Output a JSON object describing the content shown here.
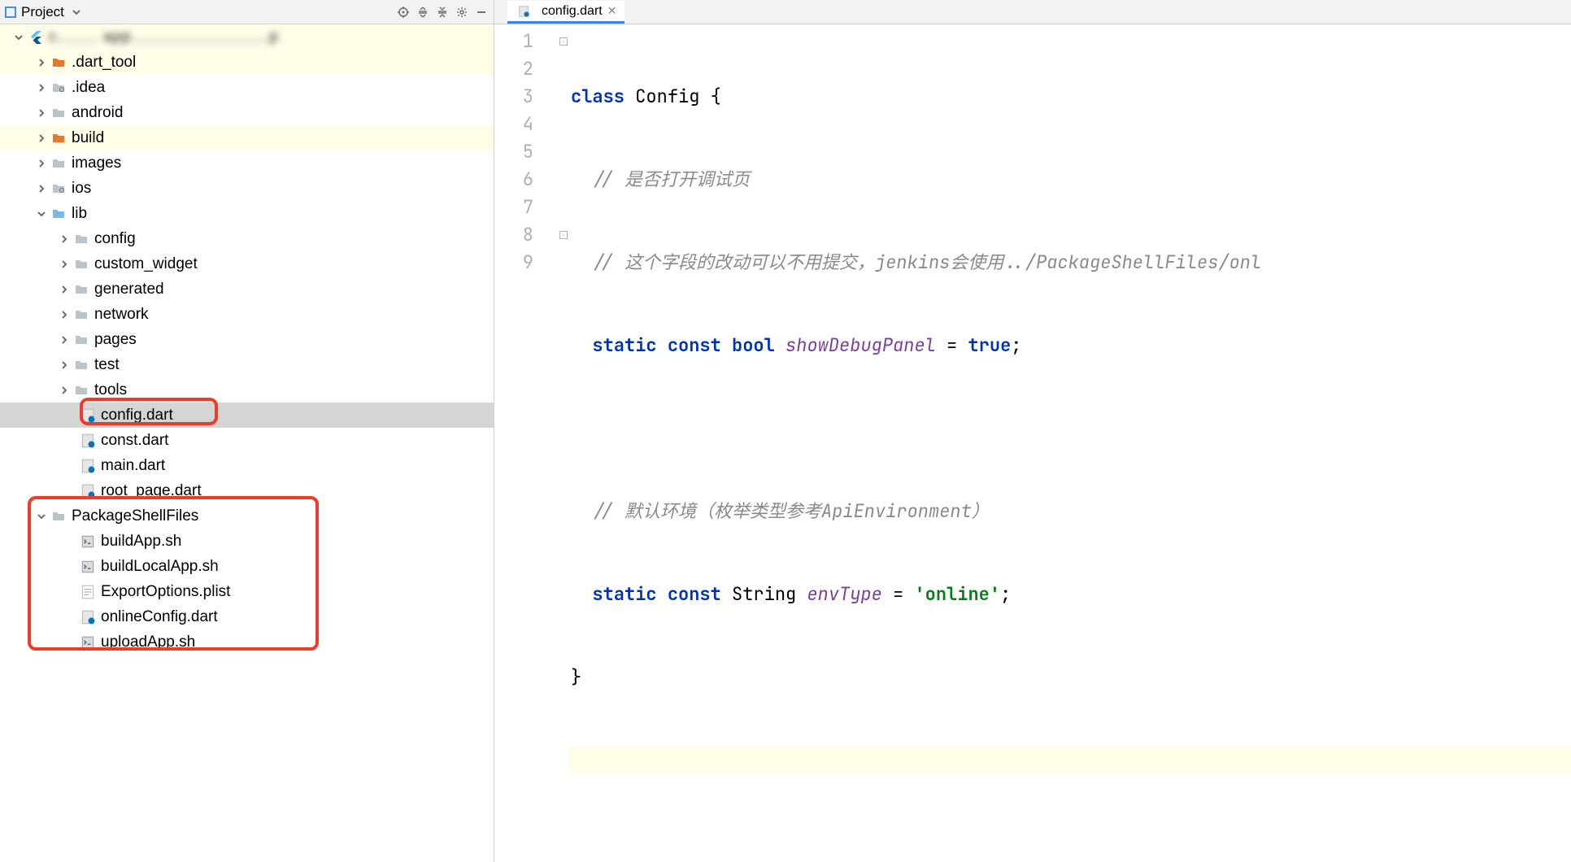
{
  "toolbar": {
    "project_label": "Project"
  },
  "tree": {
    "root_label": "c........ app...........................p",
    "items": [
      {
        "label": ".dart_tool",
        "icon": "folder-orange",
        "indent": 1,
        "arrow": "right",
        "hl": "yellow"
      },
      {
        "label": ".idea",
        "icon": "folder-gear",
        "indent": 1,
        "arrow": "right"
      },
      {
        "label": "android",
        "icon": "folder",
        "indent": 1,
        "arrow": "right"
      },
      {
        "label": "build",
        "icon": "folder-orange",
        "indent": 1,
        "arrow": "right",
        "hl": "yellow"
      },
      {
        "label": "images",
        "icon": "folder",
        "indent": 1,
        "arrow": "right"
      },
      {
        "label": "ios",
        "icon": "folder-gear",
        "indent": 1,
        "arrow": "right"
      },
      {
        "label": "lib",
        "icon": "folder-blue",
        "indent": 1,
        "arrow": "down"
      },
      {
        "label": "config",
        "icon": "folder",
        "indent": 2,
        "arrow": "right"
      },
      {
        "label": "custom_widget",
        "icon": "folder",
        "indent": 2,
        "arrow": "right"
      },
      {
        "label": "generated",
        "icon": "folder",
        "indent": 2,
        "arrow": "right"
      },
      {
        "label": "network",
        "icon": "folder",
        "indent": 2,
        "arrow": "right"
      },
      {
        "label": "pages",
        "icon": "folder",
        "indent": 2,
        "arrow": "right"
      },
      {
        "label": "test",
        "icon": "folder",
        "indent": 2,
        "arrow": "right"
      },
      {
        "label": "tools",
        "icon": "folder",
        "indent": 2,
        "arrow": "right"
      },
      {
        "label": "config.dart",
        "icon": "dart",
        "indent": 2,
        "selected": true
      },
      {
        "label": "const.dart",
        "icon": "dart",
        "indent": 2
      },
      {
        "label": "main.dart",
        "icon": "dart",
        "indent": 2
      },
      {
        "label": "root_page.dart",
        "icon": "dart",
        "indent": 2
      },
      {
        "label": "PackageShellFiles",
        "icon": "folder",
        "indent": 1,
        "arrow": "down"
      },
      {
        "label": "buildApp.sh",
        "icon": "sh",
        "indent": 2
      },
      {
        "label": "buildLocalApp.sh",
        "icon": "sh",
        "indent": 2
      },
      {
        "label": "ExportOptions.plist",
        "icon": "plist",
        "indent": 2
      },
      {
        "label": "onlineConfig.dart",
        "icon": "dart",
        "indent": 2
      },
      {
        "label": "uploadApp.sh",
        "icon": "sh",
        "indent": 2
      }
    ]
  },
  "tabs": {
    "active": {
      "label": "config.dart"
    }
  },
  "editor": {
    "lines": [
      "1",
      "2",
      "3",
      "4",
      "5",
      "6",
      "7",
      "8",
      "9"
    ],
    "code": {
      "l1_kw": "class",
      "l1_cls": " Config ",
      "l1_brace": "{",
      "l2_cm": "// 是否打开调试页",
      "l3_cm": "// 这个字段的改动可以不用提交，jenkins会使用../PackageShellFiles/onl",
      "l4_static": "static",
      "l4_const": "const",
      "l4_bool": "bool",
      "l4_id": "showDebugPanel",
      "l4_eq": " = ",
      "l4_val": "true",
      "l4_semi": ";",
      "l6_cm": "// 默认环境（枚举类型参考ApiEnvironment）",
      "l7_static": "static",
      "l7_const": "const",
      "l7_type": "String",
      "l7_id": "envType",
      "l7_eq": " = ",
      "l7_val": "'online'",
      "l7_semi": ";",
      "l8_brace": "}"
    }
  }
}
